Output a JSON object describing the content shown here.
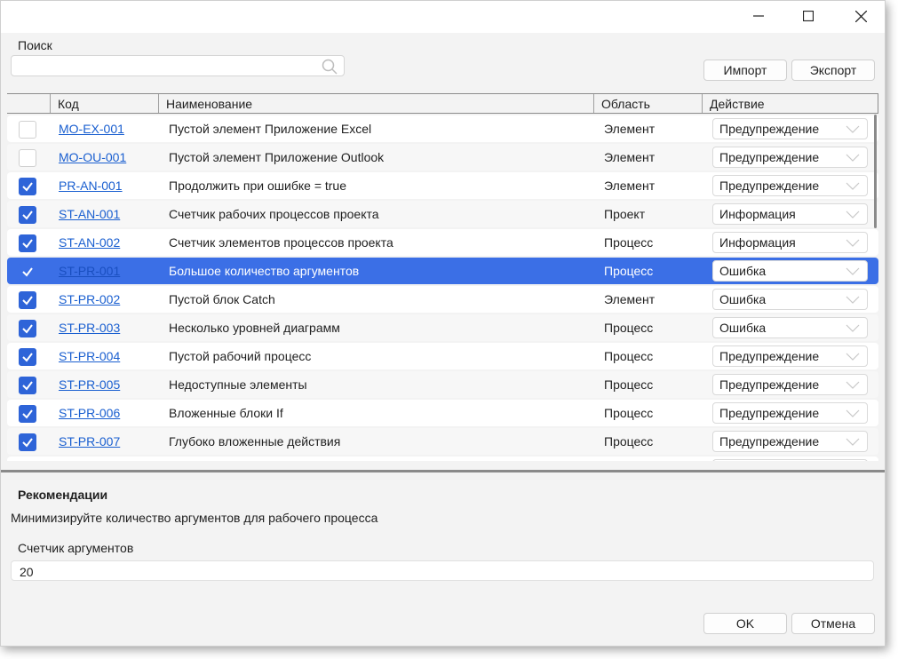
{
  "search": {
    "label": "Поиск",
    "value": "",
    "placeholder": ""
  },
  "toolbar": {
    "import_label": "Импорт",
    "export_label": "Экспорт"
  },
  "table": {
    "columns": [
      "",
      "Код",
      "Наименование",
      "Область",
      "Действие"
    ],
    "rows": [
      {
        "checked": false,
        "code": "MO-EX-001",
        "name": "Пустой элемент Приложение Excel",
        "scope": "Элемент",
        "action": "Предупреждение",
        "selected": false
      },
      {
        "checked": false,
        "code": "MO-OU-001",
        "name": "Пустой элемент Приложение Outlook",
        "scope": "Элемент",
        "action": "Предупреждение",
        "selected": false
      },
      {
        "checked": true,
        "code": "PR-AN-001",
        "name": "Продолжить при ошибке = true",
        "scope": "Элемент",
        "action": "Предупреждение",
        "selected": false
      },
      {
        "checked": true,
        "code": "ST-AN-001",
        "name": "Счетчик рабочих процессов проекта",
        "scope": "Проект",
        "action": "Информация",
        "selected": false
      },
      {
        "checked": true,
        "code": "ST-AN-002",
        "name": "Счетчик элементов процессов проекта",
        "scope": "Процесс",
        "action": "Информация",
        "selected": false
      },
      {
        "checked": true,
        "code": "ST-PR-001",
        "name": "Большое количество аргументов",
        "scope": "Процесс",
        "action": "Ошибка",
        "selected": true
      },
      {
        "checked": true,
        "code": "ST-PR-002",
        "name": "Пустой блок Catch",
        "scope": "Элемент",
        "action": "Ошибка",
        "selected": false
      },
      {
        "checked": true,
        "code": "ST-PR-003",
        "name": "Несколько уровней диаграмм",
        "scope": "Процесс",
        "action": "Ошибка",
        "selected": false
      },
      {
        "checked": true,
        "code": "ST-PR-004",
        "name": "Пустой рабочий процесс",
        "scope": "Процесс",
        "action": "Предупреждение",
        "selected": false
      },
      {
        "checked": true,
        "code": "ST-PR-005",
        "name": "Недоступные элементы",
        "scope": "Процесс",
        "action": "Предупреждение",
        "selected": false
      },
      {
        "checked": true,
        "code": "ST-PR-006",
        "name": "Вложенные блоки If",
        "scope": "Процесс",
        "action": "Предупреждение",
        "selected": false
      },
      {
        "checked": true,
        "code": "ST-PR-007",
        "name": "Глубоко вложенные действия",
        "scope": "Процесс",
        "action": "Предупреждение",
        "selected": false
      },
      {
        "checked": true,
        "code": "",
        "name": "",
        "scope": "",
        "action": "",
        "selected": false
      }
    ]
  },
  "recommendations": {
    "title": "Рекомендации",
    "text": "Минимизируйте количество аргументов для рабочего процесса",
    "param_label": "Счетчик аргументов",
    "param_value": "20"
  },
  "footer": {
    "ok_label": "OK",
    "cancel_label": "Отмена"
  },
  "colors": {
    "accent": "#3b6fe6",
    "checkbox": "#2e64d8",
    "link": "#1a5fd0"
  }
}
